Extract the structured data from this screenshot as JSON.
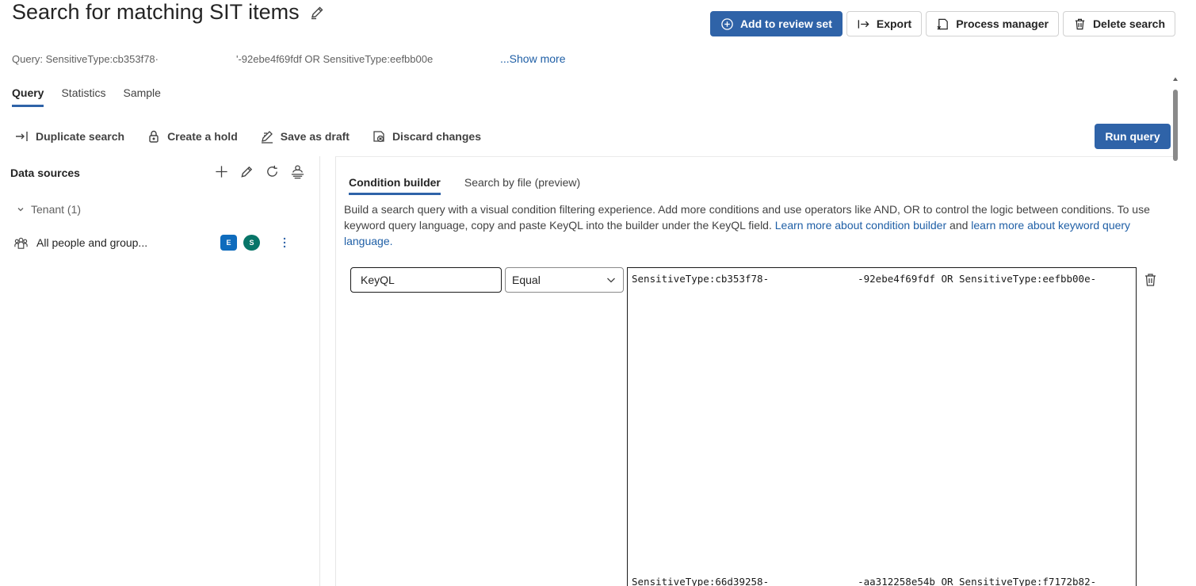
{
  "header": {
    "title": "Search for matching SIT items",
    "query_prefix": "Query: SensitiveType:cb353f78·",
    "query_suffix": "'-92ebe4f69fdf OR SensitiveType:eefbb00e",
    "show_more": "...Show more"
  },
  "actions": {
    "add_review": "Add to review set",
    "export": "Export",
    "process_manager": "Process manager",
    "delete_search": "Delete search"
  },
  "tabs": [
    "Query",
    "Statistics",
    "Sample"
  ],
  "toolbar": {
    "duplicate": "Duplicate search",
    "hold": "Create a hold",
    "draft": "Save as draft",
    "discard": "Discard changes",
    "run": "Run query"
  },
  "data_sources": {
    "title": "Data sources",
    "tenant": "Tenant (1)",
    "row_label": "All people and group...",
    "exchange_badge": "E",
    "sharepoint_badge": "S"
  },
  "builder": {
    "tab_condition": "Condition builder",
    "tab_file": "Search by file (preview)",
    "desc_text": "Build a search query with a visual condition filtering experience. Add more conditions and use operators like AND, OR to control the logic between conditions. To use keyword query language, copy and paste KeyQL into the builder under the KeyQL field. ",
    "link_condition": "Learn more about condition builder",
    "desc_and": " and ",
    "link_keyword": "learn more about keyword query language.",
    "field": "KeyQL",
    "operator": "Equal",
    "line1_a": "SensitiveType:cb353f78-",
    "line1_b": "-92ebe4f69fdf OR SensitiveType:eefbb00e-",
    "line2_a": "SensitiveType:66d39258-",
    "line2_b": "-aa312258e54b OR SensitiveType:f7172b82-"
  },
  "icons": {
    "edit": "edit-icon",
    "add_circle": "add-circle-icon",
    "export": "export-arrow-icon",
    "process": "process-manager-icon",
    "delete": "trash-icon",
    "duplicate": "duplicate-icon",
    "hold": "lock-icon",
    "draft": "draft-icon",
    "discard": "discard-icon",
    "people": "people-icon",
    "more": "more-vertical-icon"
  },
  "colors": {
    "primary": "#2f63a8",
    "link": "#1f5fa6",
    "exchange": "#0f6cbd",
    "sharepoint": "#077568"
  }
}
